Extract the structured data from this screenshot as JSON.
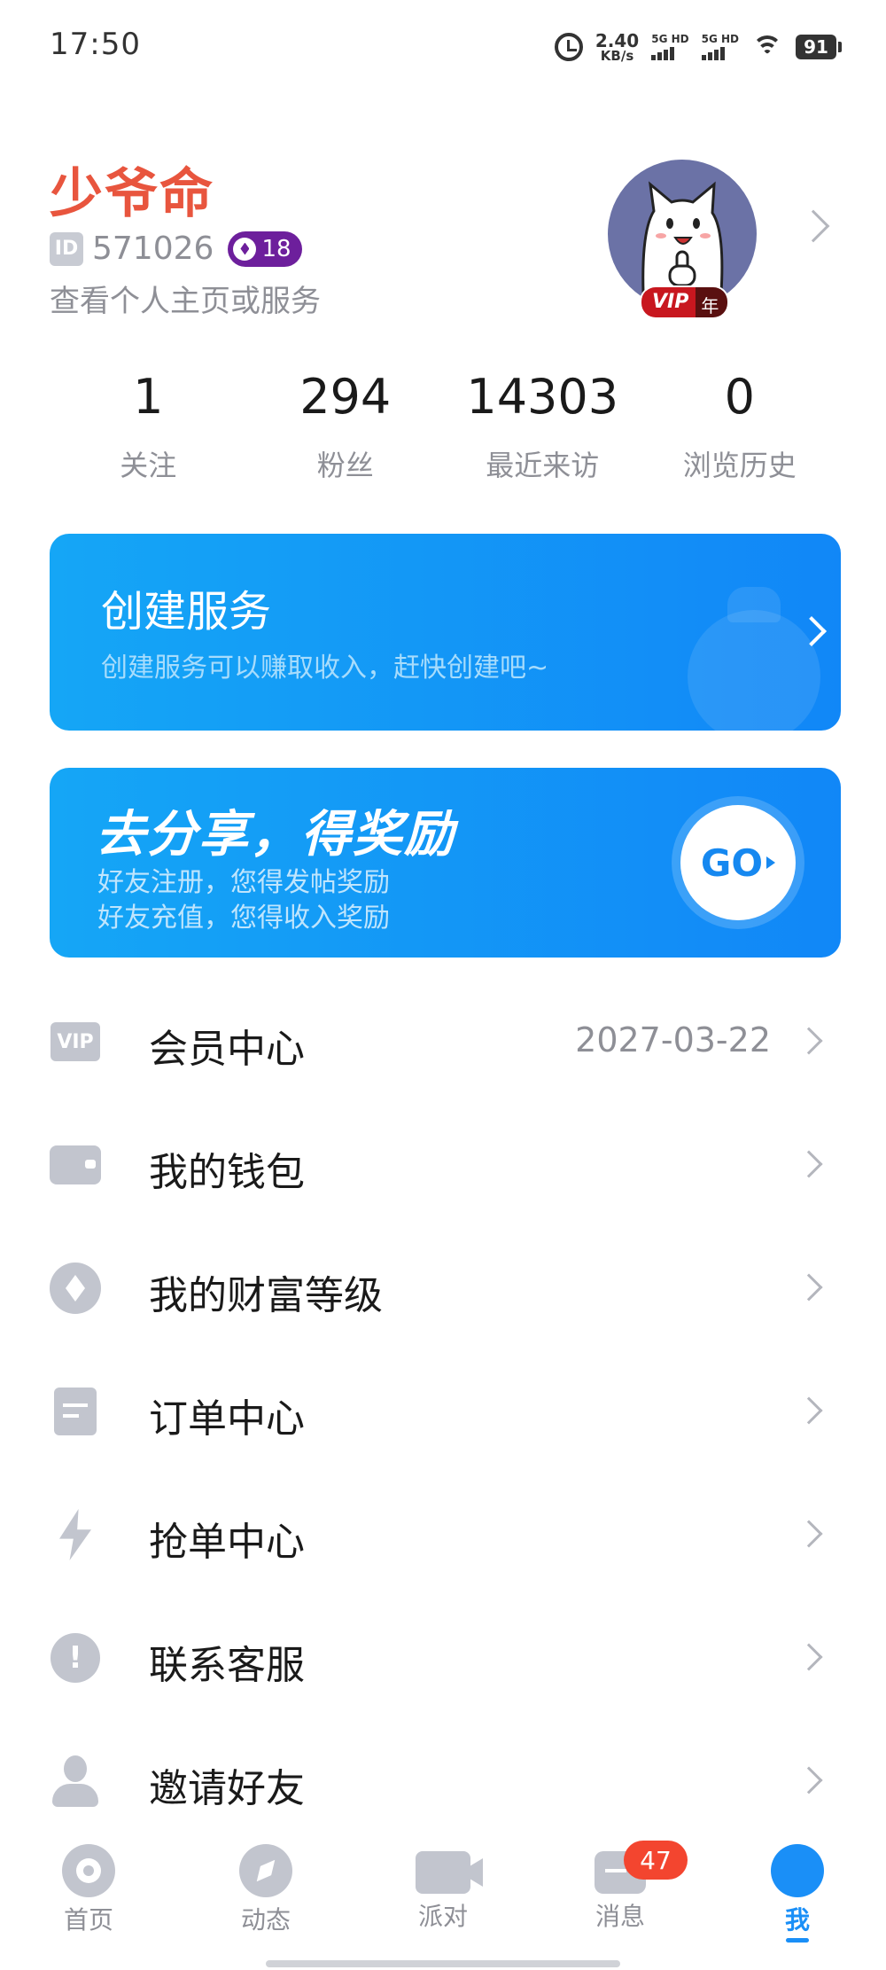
{
  "status_bar": {
    "time": "17:50",
    "net_speed_value": "2.40",
    "net_speed_unit": "KB/s",
    "sim1_label": "5G HD",
    "sim2_label": "5G HD",
    "battery": "91"
  },
  "profile": {
    "username": "少爷命",
    "id_badge": "ID",
    "id_number": "571026",
    "level": "18",
    "subtitle": "查看个人主页或服务",
    "vip_label": "VIP",
    "vip_period": "年"
  },
  "stats": [
    {
      "value": "1",
      "label": "关注"
    },
    {
      "value": "294",
      "label": "粉丝"
    },
    {
      "value": "14303",
      "label": "最近来访"
    },
    {
      "value": "0",
      "label": "浏览历史"
    }
  ],
  "create_banner": {
    "title": "创建服务",
    "desc": "创建服务可以赚取收入，赶快创建吧~"
  },
  "share_banner": {
    "title": "去分享，得奖励",
    "line1": "好友注册，您得发帖奖励",
    "line2": "好友充值，您得收入奖励",
    "go_label": "GO"
  },
  "menu": [
    {
      "label": "会员中心",
      "value": "2027-03-22",
      "icon": "vip-icon",
      "icon_text": "VIP"
    },
    {
      "label": "我的钱包",
      "value": "",
      "icon": "wallet-icon"
    },
    {
      "label": "我的财富等级",
      "value": "",
      "icon": "diamond-icon"
    },
    {
      "label": "订单中心",
      "value": "",
      "icon": "order-icon"
    },
    {
      "label": "抢单中心",
      "value": "",
      "icon": "lightning-icon"
    },
    {
      "label": "联系客服",
      "value": "",
      "icon": "help-icon",
      "icon_text": "!"
    },
    {
      "label": "邀请好友",
      "value": "",
      "icon": "user-icon"
    }
  ],
  "bottom_nav": [
    {
      "label": "首页",
      "icon": "home-icon"
    },
    {
      "label": "动态",
      "icon": "compass-icon"
    },
    {
      "label": "派对",
      "icon": "video-icon"
    },
    {
      "label": "消息",
      "icon": "message-icon",
      "badge": "47"
    },
    {
      "label": "我",
      "icon": "me-icon",
      "active": true
    }
  ],
  "colors": {
    "username": "#e8553e",
    "banner_blue": "#1187f7",
    "accent": "#1a8ff7",
    "badge_red": "#f3452f",
    "level_purple": "#6d1f9c"
  }
}
